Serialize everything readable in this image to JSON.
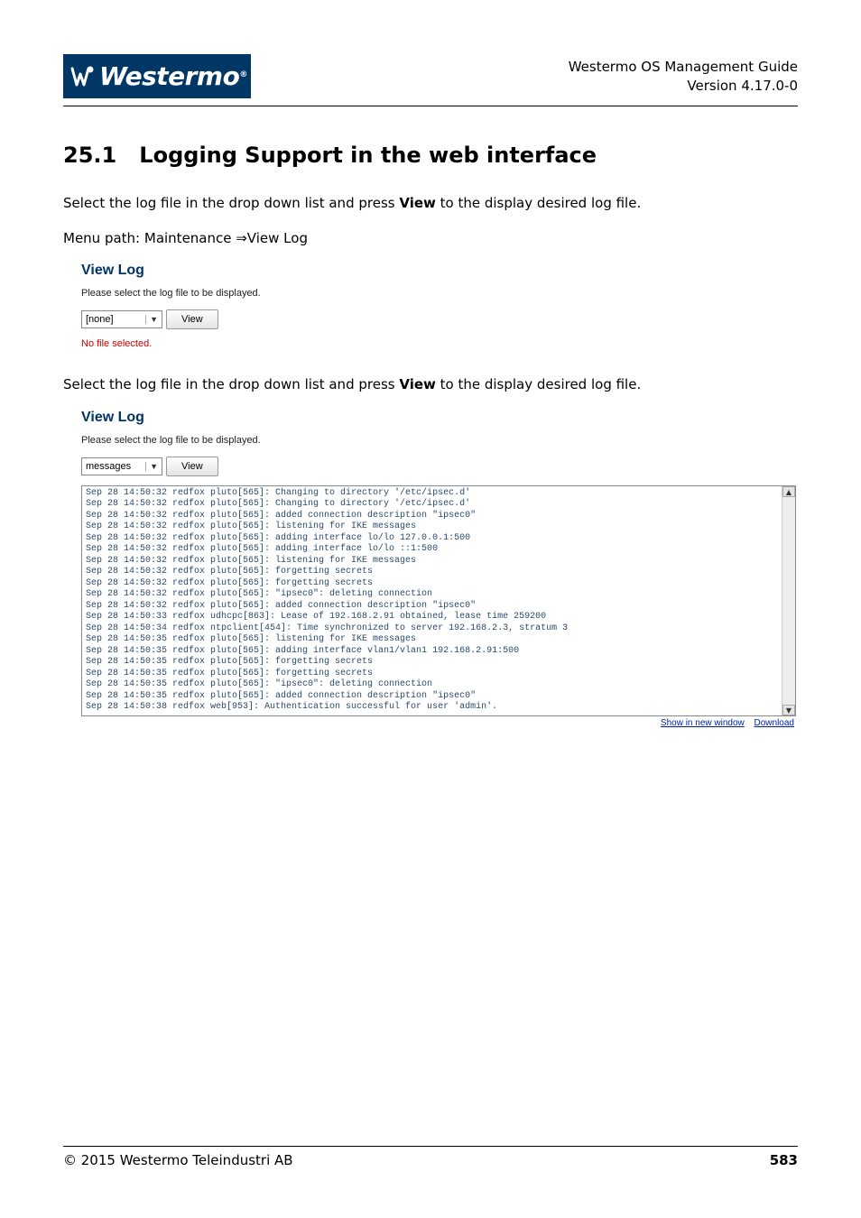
{
  "header": {
    "logo_text": "Westermo",
    "guide_title": "Westermo OS Management Guide",
    "version": "Version 4.17.0-0"
  },
  "section": {
    "number": "25.1",
    "title": "Logging Support in the web interface"
  },
  "body": {
    "para1_a": "Select the log file in the drop down list and press ",
    "para1_b": "View",
    "para1_c": " to the display desired log file.",
    "menu_path": "Menu path: Maintenance ⇒View Log",
    "para2_a": "Select the log file in the drop down list and press ",
    "para2_b": "View",
    "para2_c": " to the display desired log file."
  },
  "fig1": {
    "title": "View Log",
    "subtitle": "Please select the log file to be displayed.",
    "dropdown_value": "[none]",
    "button_label": "View",
    "no_file_msg": "No file selected."
  },
  "fig2": {
    "title": "View Log",
    "subtitle": "Please select the log file to be displayed.",
    "dropdown_value": "messages",
    "button_label": "View",
    "log_lines": [
      "Sep 28 14:50:32 redfox pluto[565]: Changing to directory '/etc/ipsec.d'",
      "Sep 28 14:50:32 redfox pluto[565]: Changing to directory '/etc/ipsec.d'",
      "Sep 28 14:50:32 redfox pluto[565]: added connection description \"ipsec0\"",
      "Sep 28 14:50:32 redfox pluto[565]: listening for IKE messages",
      "Sep 28 14:50:32 redfox pluto[565]: adding interface lo/lo 127.0.0.1:500",
      "Sep 28 14:50:32 redfox pluto[565]: adding interface lo/lo ::1:500",
      "Sep 28 14:50:32 redfox pluto[565]: listening for IKE messages",
      "Sep 28 14:50:32 redfox pluto[565]: forgetting secrets",
      "Sep 28 14:50:32 redfox pluto[565]: forgetting secrets",
      "Sep 28 14:50:32 redfox pluto[565]: \"ipsec0\": deleting connection",
      "Sep 28 14:50:32 redfox pluto[565]: added connection description \"ipsec0\"",
      "Sep 28 14:50:33 redfox udhcpc[863]: Lease of 192.168.2.91 obtained, lease time 259200",
      "Sep 28 14:50:34 redfox ntpclient[454]: Time synchronized to server 192.168.2.3, stratum 3",
      "Sep 28 14:50:35 redfox pluto[565]: listening for IKE messages",
      "Sep 28 14:50:35 redfox pluto[565]: adding interface vlan1/vlan1 192.168.2.91:500",
      "Sep 28 14:50:35 redfox pluto[565]: forgetting secrets",
      "Sep 28 14:50:35 redfox pluto[565]: forgetting secrets",
      "Sep 28 14:50:35 redfox pluto[565]: \"ipsec0\": deleting connection",
      "Sep 28 14:50:35 redfox pluto[565]: added connection description \"ipsec0\"",
      "Sep 28 14:50:38 redfox web[953]: Authentication successful for user 'admin'."
    ],
    "link_show": "Show in new window",
    "link_download": "Download"
  },
  "footer": {
    "copyright": "© 2015 Westermo Teleindustri AB",
    "page": "583"
  }
}
